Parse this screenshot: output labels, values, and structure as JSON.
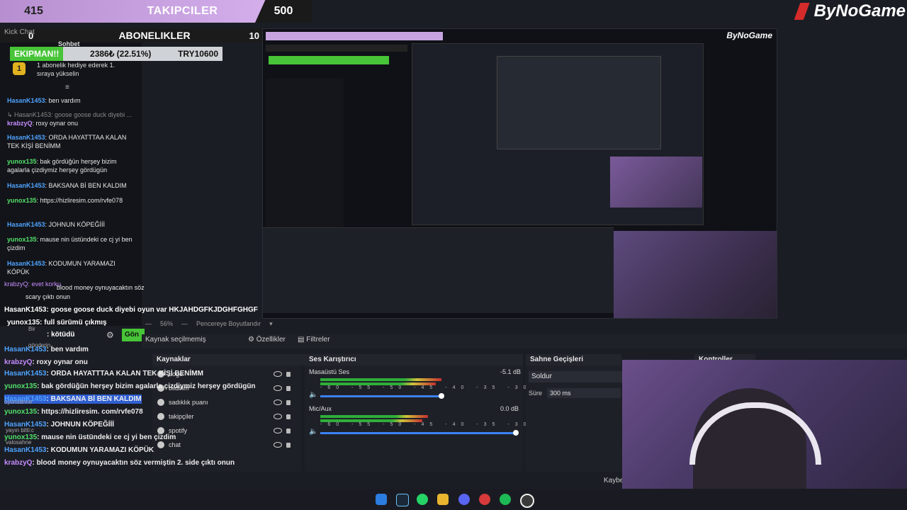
{
  "overlay": {
    "followers_count_left": "415",
    "followers_label": "TAKIPCILER",
    "followers_count_right": "500",
    "subs_count_left": "0",
    "subs_label": "ABONELIKLER",
    "subs_count_right": "10",
    "goal_left": "EKIPMAN!!",
    "goal_mid": "2386₺ (22.51%)",
    "goal_right": "TRY10600",
    "brand": "ByNoGame"
  },
  "chat": {
    "header": "Kick Chat",
    "header_tab": "Sohbet",
    "gift_text": "1 abonelik hediye ederek 1. sıraya yükselin",
    "messages": [
      {
        "user": "HasanK1453",
        "text": ": ben vardım",
        "color": "#4da3ff"
      },
      {
        "user": "",
        "text": "↳ HasanK1453: goose goose duck diyebi ...",
        "color": "#888888"
      },
      {
        "user": "krabzyQ",
        "text": ": roxy oynar onu",
        "color": "#c58cff"
      },
      {
        "user": "HasanK1453",
        "text": ": ORDA HAYATTTAA KALAN TEK KİŞİ BENİMM",
        "color": "#4da3ff"
      },
      {
        "user": "yunox135",
        "text": ": bak gördüğün herşey bizim agalarla çizdiymiz herşey gördügün",
        "color": "#52e06a"
      },
      {
        "user": "HasanK1453",
        "text": ": BAKSANA Bİ BEN KALDIM",
        "color": "#4da3ff"
      },
      {
        "user": "yunox135",
        "text": ": https://hizliresim.com/rvfe078",
        "color": "#52e06a"
      },
      {
        "user": "HasanK1453",
        "text": ": JOHNUN KÖPEĞİİİ",
        "color": "#4da3ff"
      },
      {
        "user": "yunox135",
        "text": ": mause nin üstündeki ce cj yi ben çizdim",
        "color": "#52e06a"
      },
      {
        "user": "HasanK1453",
        "text": ": KODUMUN YARAMAZI KÖPÜK",
        "color": "#4da3ff"
      }
    ],
    "overlap_1": "krabzyQ: evet korku",
    "overlap_2": "blood money oynuyacaktın söz",
    "overlap_3": "scary çıktı onun",
    "goose_line": "HasanK1453: goose goose duck diyebi oyun var HKJAHDGFKJDGHFGHGF",
    "full_line": "yunox135: full sürümü çıkmış",
    "kotu_line": ": kötüdü",
    "send_label": "Gön",
    "bottom_lines": [
      {
        "user": "HasanK1453",
        "text": ": ben vardım"
      },
      {
        "user": "krabzyQ",
        "text": ": roxy oynar onu"
      },
      {
        "user": "HasanK1453",
        "text": ": ORDA HAYATTTAA KALAN TEK KİŞİ BENİMM"
      },
      {
        "user": "yunox135",
        "text": ": bak gördüğün herşey bizim agalarla çizdiymiz herşey gördügün"
      },
      {
        "user": "HasanK1453",
        "text": ": BAKSANA Bİ BEN KALDIM"
      },
      {
        "user": "yunox135",
        "text": ": https://hizliresim. com/rvfe078"
      },
      {
        "user": "HasanK1453",
        "text": ": JOHNUN KÖPEĞİİİ"
      },
      {
        "user": "yunox135",
        "text": ": mause nin üstündeki ce cj yi ben çizdim"
      },
      {
        "user": "HasanK1453",
        "text": ": KODUMUN YARAMAZI KÖPÜK"
      },
      {
        "user": "krabzyQ",
        "text": ": blood money oynuyacaktın söz vermiştin 2. side çıktı onun"
      }
    ],
    "small_notes": [
      "oyunsahne",
      "yayın bitti:c",
      "valosahne",
      "Bir",
      "gönderin"
    ]
  },
  "viewbar": {
    "zoom": "56%",
    "mode": "Pencereye Boyutlandır"
  },
  "toolbar": {
    "source_selected": "Kaynak seçilmemiş",
    "properties": "Özellikler",
    "filters": "Filtreler"
  },
  "docks": {
    "sources_title": "Kaynaklar",
    "mixer_title": "Ses Karıştırıcı",
    "transitions_title": "Sahne Geçişleri",
    "controls_title": "Kontroller"
  },
  "sources": [
    {
      "name": "Logo"
    },
    {
      "name": "bildirim"
    },
    {
      "name": "sadıklık puanı"
    },
    {
      "name": "takipçiler"
    },
    {
      "name": "spotify"
    },
    {
      "name": "chat"
    }
  ],
  "mixer": {
    "tracks": [
      {
        "name": "Masaüstü Ses",
        "db": "-5.1 dB",
        "level": 0.62,
        "volume": 0.62
      },
      {
        "name": "Mic/Aux",
        "db": "0.0 dB",
        "level": 0.55,
        "volume": 1.0
      }
    ],
    "ticks": "-60 -55 -50 -45 -40 -35 -30 -25 -20 -15 -10 -5 0"
  },
  "transitions": {
    "type": "Soldur",
    "duration_label": "Süre",
    "duration_value": "300 ms"
  },
  "misc": {
    "kaybec": "Kaybec"
  },
  "colors": {
    "accent_green": "#47c437",
    "follower_bar": "#c7a4df",
    "brand_red": "#d62b2b"
  }
}
